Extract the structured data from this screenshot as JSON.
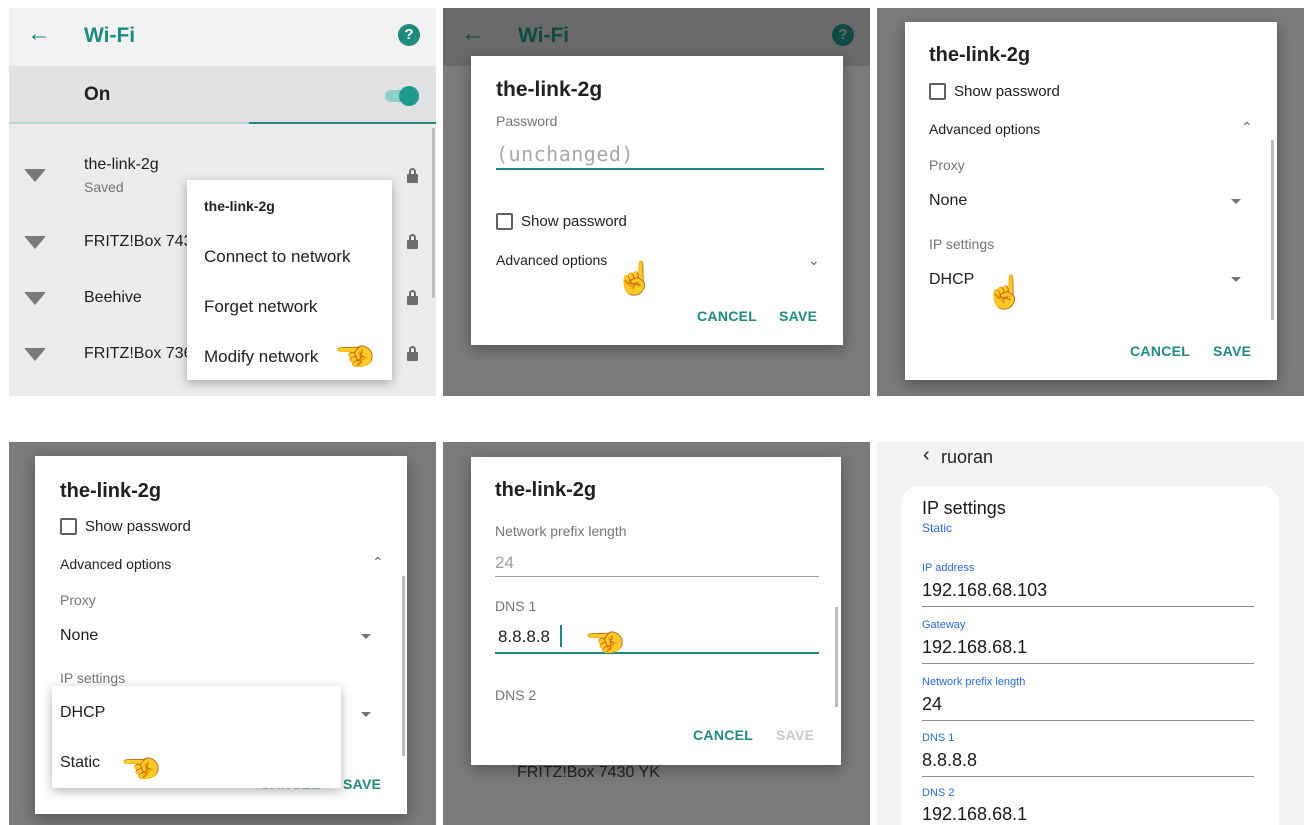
{
  "panel1": {
    "title": "Wi-Fi",
    "help": "?",
    "switch_label": "On",
    "networks": [
      {
        "name": "the-link-2g",
        "status": "Saved"
      },
      {
        "name": "FRITZ!Box 743",
        "status": ""
      },
      {
        "name": "Beehive",
        "status": ""
      },
      {
        "name": "FRITZ!Box 736",
        "status": ""
      }
    ],
    "menu": {
      "header": "the-link-2g",
      "items": [
        "Connect to network",
        "Forget network",
        "Modify network"
      ]
    }
  },
  "panel2": {
    "bg_title": "Wi-Fi",
    "dialog_title": "the-link-2g",
    "password_label": "Password",
    "password_placeholder": "(unchanged)",
    "show_password": "Show password",
    "advanced_options": "Advanced options",
    "cancel": "CANCEL",
    "save": "SAVE"
  },
  "panel3": {
    "dialog_title": "the-link-2g",
    "show_password": "Show password",
    "advanced_options": "Advanced options",
    "proxy_label": "Proxy",
    "proxy_value": "None",
    "ip_label": "IP settings",
    "ip_value": "DHCP",
    "cancel": "CANCEL",
    "save": "SAVE"
  },
  "panel4": {
    "dialog_title": "the-link-2g",
    "show_password": "Show password",
    "advanced_options": "Advanced options",
    "proxy_label": "Proxy",
    "proxy_value": "None",
    "ip_label": "IP settings",
    "options": [
      "DHCP",
      "Static"
    ],
    "cancel": "CANCEL",
    "save": "SAVE"
  },
  "panel5": {
    "dialog_title": "the-link-2g",
    "prefix_label": "Network prefix length",
    "prefix_value": "24",
    "dns1_label": "DNS 1",
    "dns1_value": "8.8.8.8",
    "dns2_label": "DNS 2",
    "cancel": "CANCEL",
    "save": "SAVE",
    "bg_network": "FRITZ!Box 7430 YK"
  },
  "panel6": {
    "back_title": "ruoran",
    "section_title": "IP settings",
    "section_value": "Static",
    "fields": [
      {
        "label": "IP address",
        "value": "192.168.68.103"
      },
      {
        "label": "Gateway",
        "value": "192.168.68.1"
      },
      {
        "label": "Network prefix length",
        "value": "24"
      },
      {
        "label": "DNS 1",
        "value": "8.8.8.8"
      },
      {
        "label": "DNS 2",
        "value": "192.168.68.1"
      }
    ]
  },
  "colors": {
    "accent": "#1f8a7f",
    "link_blue": "#2b6bd6",
    "scrim": "#7b7b7b"
  },
  "icons": [
    "back-arrow-icon",
    "help-icon",
    "wifi-icon",
    "lock-icon",
    "checkbox-icon",
    "chevron-icon",
    "dropdown-icon",
    "hand-pointer-icon"
  ]
}
